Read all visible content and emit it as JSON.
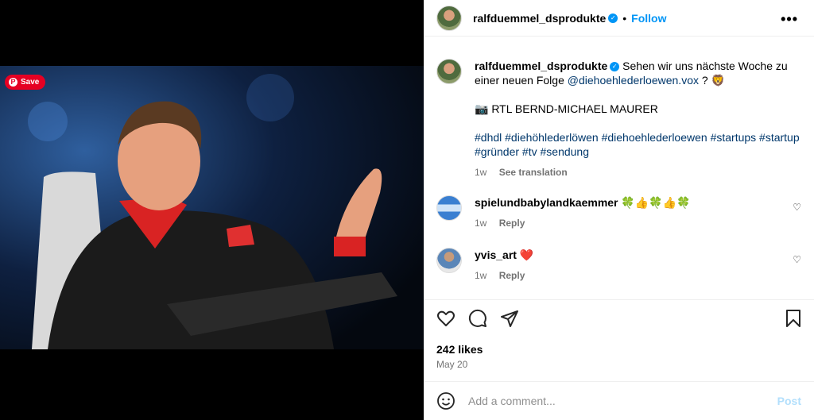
{
  "save_button": {
    "label": "Save"
  },
  "post": {
    "username": "ralfduemmel_dsprodukte",
    "follow_label": "Follow",
    "caption_text": "Sehen wir uns nächste Woche zu einer neuen Folge",
    "caption_mention": "@diehoehlederloewen.vox",
    "caption_tail": " ? 🦁",
    "photo_credit": "📷 RTL BERND-MICHAEL MAURER",
    "hashtags": "#dhdl #diehöhlederlöwen #diehoehlederloewen #startups #startup #gründer #tv #sendung",
    "caption_age": "1w",
    "see_translation": "See translation",
    "likes": "242 likes",
    "date": "May 20"
  },
  "comments": [
    {
      "username": "spielundbabylandkaemmer",
      "text": "🍀👍🍀👍🍀",
      "age": "1w",
      "reply": "Reply"
    },
    {
      "username": "yvis_art",
      "text": "❤️",
      "age": "1w",
      "reply": "Reply"
    }
  ],
  "add_comment": {
    "placeholder": "Add a comment...",
    "post_label": "Post"
  },
  "icons": [
    "verified-icon",
    "more-options-icon",
    "heart-icon",
    "comment-icon",
    "share-icon",
    "bookmark-icon",
    "emoji-icon"
  ]
}
